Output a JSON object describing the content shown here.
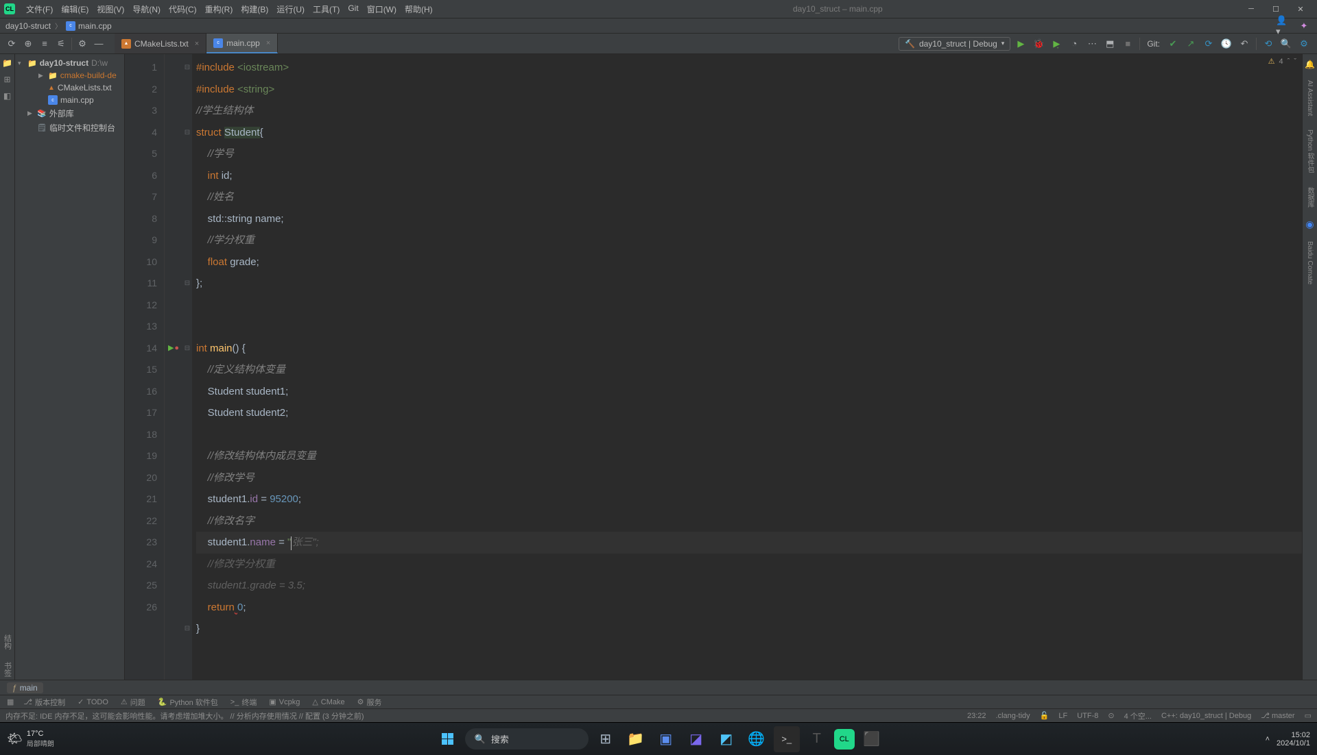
{
  "titlebar": {
    "menus": [
      "文件(F)",
      "编辑(E)",
      "视图(V)",
      "导航(N)",
      "代码(C)",
      "重构(R)",
      "构建(B)",
      "运行(U)",
      "工具(T)",
      "Git",
      "窗口(W)",
      "帮助(H)"
    ],
    "title": "day10_struct – main.cpp"
  },
  "breadcrumb": {
    "project": "day10-struct",
    "file": "main.cpp"
  },
  "toolbar": {
    "tabs": [
      {
        "name": "CMakeLists.txt",
        "active": false
      },
      {
        "name": "main.cpp",
        "active": true
      }
    ],
    "run_config": "day10_struct | Debug",
    "git_label": "Git:"
  },
  "tree": {
    "root": {
      "name": "day10-struct",
      "path": "D:\\w"
    },
    "items": [
      {
        "name": "cmake-build-de",
        "depth": 1,
        "orange": true,
        "folder": true,
        "arrow": "▶"
      },
      {
        "name": "CMakeLists.txt",
        "depth": 1,
        "cmake": true
      },
      {
        "name": "main.cpp",
        "depth": 1,
        "cpp": true
      },
      {
        "name": "外部库",
        "depth": 0,
        "arrow": "▶",
        "lib": true
      },
      {
        "name": "临时文件和控制台",
        "depth": 0,
        "scratch": true
      }
    ]
  },
  "editor": {
    "warning_count": "4",
    "lines_nums": [
      "1",
      "2",
      "3",
      "4",
      "5",
      "6",
      "7",
      "8",
      "9",
      "10",
      "11",
      "12",
      "13",
      "14",
      "15",
      "16",
      "17",
      "18",
      "19",
      "20",
      "21",
      "22",
      "23",
      "",
      "",
      "24",
      "25",
      "26"
    ],
    "code": [
      {
        "t": "pp",
        "parts": [
          [
            "pp",
            "#include "
          ],
          [
            "inc",
            "<iostream>"
          ]
        ]
      },
      {
        "t": "pp",
        "parts": [
          [
            "pp",
            "#include "
          ],
          [
            "inc",
            "<string>"
          ]
        ]
      },
      {
        "t": "c",
        "parts": [
          [
            "cmt",
            "//学生结构体"
          ]
        ]
      },
      {
        "t": "n",
        "parts": [
          [
            "kw",
            "struct "
          ],
          [
            "classname",
            "Student"
          ],
          [
            "op",
            "{"
          ]
        ]
      },
      {
        "t": "n",
        "parts": [
          [
            "op",
            "    "
          ],
          [
            "cmt",
            "//学号"
          ]
        ]
      },
      {
        "t": "n",
        "parts": [
          [
            "op",
            "    "
          ],
          [
            "kw",
            "int "
          ],
          [
            "id",
            "id"
          ],
          [
            "op",
            ";"
          ]
        ]
      },
      {
        "t": "n",
        "parts": [
          [
            "op",
            "    "
          ],
          [
            "cmt",
            "//姓名"
          ]
        ]
      },
      {
        "t": "n",
        "parts": [
          [
            "op",
            "    "
          ],
          [
            "id",
            "std::"
          ],
          [
            "type",
            "string "
          ],
          [
            "id",
            "name"
          ],
          [
            "op",
            ";"
          ]
        ]
      },
      {
        "t": "n",
        "parts": [
          [
            "op",
            "    "
          ],
          [
            "cmt",
            "//学分权重"
          ]
        ]
      },
      {
        "t": "n",
        "parts": [
          [
            "op",
            "    "
          ],
          [
            "kw",
            "float "
          ],
          [
            "id",
            "grade"
          ],
          [
            "op",
            ";"
          ]
        ]
      },
      {
        "t": "n",
        "parts": [
          [
            "op",
            "};"
          ]
        ]
      },
      {
        "t": "blank"
      },
      {
        "t": "blank"
      },
      {
        "t": "n",
        "parts": [
          [
            "kw",
            "int "
          ],
          [
            "fn",
            "main"
          ],
          [
            "op",
            "() {"
          ]
        ]
      },
      {
        "t": "n",
        "parts": [
          [
            "op",
            "    "
          ],
          [
            "cmt",
            "//定义结构体变量"
          ]
        ]
      },
      {
        "t": "n",
        "parts": [
          [
            "op",
            "    "
          ],
          [
            "id",
            "Student student1"
          ],
          [
            "op",
            ";"
          ]
        ]
      },
      {
        "t": "n",
        "parts": [
          [
            "op",
            "    "
          ],
          [
            "id",
            "Student student2"
          ],
          [
            "op",
            ";"
          ]
        ]
      },
      {
        "t": "blank"
      },
      {
        "t": "n",
        "parts": [
          [
            "op",
            "    "
          ],
          [
            "cmt",
            "//修改结构体内成员变量"
          ]
        ]
      },
      {
        "t": "n",
        "parts": [
          [
            "op",
            "    "
          ],
          [
            "cmt",
            "//修改学号"
          ]
        ]
      },
      {
        "t": "n",
        "parts": [
          [
            "op",
            "    "
          ],
          [
            "id",
            "student1."
          ],
          [
            "field",
            "id"
          ],
          [
            "op",
            " = "
          ],
          [
            "num",
            "95200"
          ],
          [
            "op",
            ";"
          ]
        ]
      },
      {
        "t": "n",
        "parts": [
          [
            "op",
            "    "
          ],
          [
            "cmt",
            "//修改名字"
          ]
        ]
      },
      {
        "t": "cursor",
        "parts": [
          [
            "op",
            "    "
          ],
          [
            "id",
            "student1."
          ],
          [
            "field",
            "name"
          ],
          [
            "op",
            " = "
          ],
          [
            "str",
            "\""
          ],
          [
            "caret",
            ""
          ],
          [
            "cmt-gray",
            "张三\";"
          ]
        ]
      },
      {
        "t": "n",
        "parts": [
          [
            "op",
            "    "
          ],
          [
            "cmt-gray",
            "//修改学分权重"
          ]
        ]
      },
      {
        "t": "n",
        "parts": [
          [
            "op",
            "    "
          ],
          [
            "cmt-gray",
            "student1.grade = 3.5;"
          ]
        ]
      },
      {
        "t": "n",
        "parts": [
          [
            "op",
            "    "
          ],
          [
            "kw",
            "return"
          ],
          [
            "underline-wavy",
            " "
          ],
          [
            "num",
            "0"
          ],
          [
            "op",
            ";"
          ]
        ]
      },
      {
        "t": "n",
        "parts": [
          [
            "op",
            "}"
          ]
        ]
      },
      {
        "t": "blank"
      }
    ],
    "fn_crumb": "main"
  },
  "bottombar": {
    "items": [
      "版本控制",
      "TODO",
      "问题",
      "Python 软件包",
      "终端",
      "Vcpkg",
      "CMake",
      "服务"
    ]
  },
  "status": {
    "msg": "内存不足: IDE 内存不足，这可能会影响性能。请考虑增加堆大小。 // 分析内存使用情况 // 配置 (3 分钟之前)",
    "pos": "23:22",
    "clang": ".clang-tidy",
    "sep": "LF",
    "enc": "UTF-8",
    "spaces": "4 个空...",
    "context": "C++: day10_struct | Debug",
    "branch": "master"
  },
  "taskbar": {
    "temp": "17°C",
    "weather": "局部晴朗",
    "search": "搜索",
    "time": "15:02",
    "date": "2024/10/1"
  }
}
